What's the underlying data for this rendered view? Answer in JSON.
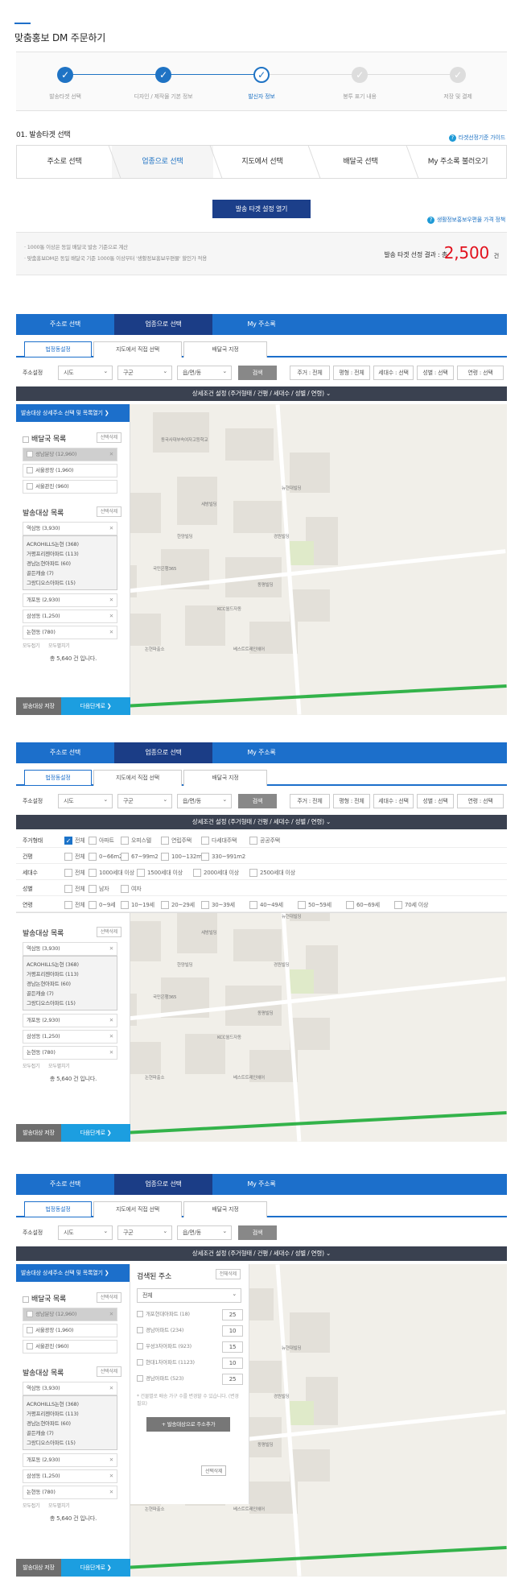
{
  "page": {
    "title": "맞춤홍보 DM 주문하기"
  },
  "steps": [
    {
      "label": "발송타겟 선택",
      "state": "done"
    },
    {
      "label": "디자인 / 제작물 기본 정보",
      "state": "done"
    },
    {
      "label": "발신자 정보",
      "state": "current"
    },
    {
      "label": "봉투 표기 내용",
      "state": "todo"
    },
    {
      "label": "저장 및 결제",
      "state": "todo"
    }
  ],
  "section1": {
    "title": "01. 발송타겟 선택",
    "guide": "타겟선정기준 가이드",
    "tabs": [
      "주소로 선택",
      "업종으로 선택",
      "지도에서 선택",
      "배달국 선택",
      "My 주소록 불러오기"
    ],
    "selected_tab": 1,
    "open_button": "발송 타겟 설정 열기",
    "price_link": "생활정보홍보우편물 가격 정책",
    "note1": "· 1000통 이상은 동일 배달국 발송 기준으로 계산",
    "note2": "· 맞춤홍보DM은 동일 배달국 기준 1000통 이상부터 '생활정보홍보우편물' 할인가 적용",
    "result_label": "발송 타겟 선정 결과 : 총",
    "result_value": "2,500",
    "result_unit": "건"
  },
  "module": {
    "nav": [
      "주소로 선택",
      "업종으로 선택",
      "My 주소록"
    ],
    "subtabs": [
      "법정동설정",
      "지도에서 직접 선택",
      "배달국 지정"
    ],
    "addr_label": "주소설정",
    "selects": [
      "시도",
      "구군",
      "읍/면/동"
    ],
    "search": "검색",
    "chips": [
      "주거 : 전체",
      "평형 : 전체",
      "세대수 : 선택",
      "성별 : 선택",
      "연령 : 선택"
    ],
    "cond_bar": "상세조건 설정 (주거형태 / 건평 / 세대수 / 성별 / 연령)  ⌄"
  },
  "side": {
    "header": "발송대상 상세주소 선택 및 목록열기  ❯",
    "office_title": "배달국 목록",
    "delete": "선택삭제",
    "offices": [
      "성남분당 (12,960)",
      "서울광장 (1,960)",
      "서울관진 (960)"
    ],
    "target_title": "발송대상 목록",
    "targets": [
      {
        "name": "역삼동 (3,930)"
      },
      {
        "name": "개포동 (2,930)"
      },
      {
        "name": "삼성동 (1,250)"
      },
      {
        "name": "논현동 (780)"
      }
    ],
    "sub_items": [
      "ACROHILLS논현 (368)",
      "거평프리젠아파트 (113)",
      "경남논현아파트 (60)",
      "골든캐슬 (7)",
      "그랑디오스아파트 (15)"
    ],
    "fold_all": "모두접기",
    "unfold_all": "모두펼치기",
    "total": "총 5,640 건 입니다.",
    "save_btn": "발송대상 저장",
    "next_btn": "다음단계로  ❯"
  },
  "filters": [
    {
      "label": "주거형태",
      "opts": [
        "전체",
        "아파트",
        "오피스텔",
        "연립주택",
        "다세대주택",
        "공공주택"
      ]
    },
    {
      "label": "건평",
      "opts": [
        "전체",
        "0~66m2",
        "67~99m2",
        "100~132m2",
        "330~991m2"
      ]
    },
    {
      "label": "세대수",
      "opts": [
        "전체",
        "1000세대 이상",
        "1500세대 이상",
        "2000세대 이상",
        "2500세대 이상"
      ]
    },
    {
      "label": "성별",
      "opts": [
        "전체",
        "남자",
        "여자"
      ]
    },
    {
      "label": "연령",
      "opts": [
        "전체",
        "0~9세",
        "10~19세",
        "20~29세",
        "30~39세",
        "40~49세",
        "50~59세",
        "60~69세",
        "70세 이상"
      ]
    }
  ],
  "search_result": {
    "title": "검색된 주소",
    "delete": "전체삭제",
    "select": "전체",
    "items": [
      {
        "name": "개포현대아파트 (18)",
        "val": "25"
      },
      {
        "name": "경남아파트 (234)",
        "val": "10"
      },
      {
        "name": "우성3차아파트 (923)",
        "val": "15"
      },
      {
        "name": "현대1차아파트 (1123)",
        "val": "10"
      },
      {
        "name": "경남아파트 (523)",
        "val": "25"
      }
    ],
    "note": "* 건물별로 배송 가구 수를 변경할 수 있습니다. (변경 필요)",
    "add_btn": "+ 발송대상으로 주소추가",
    "map_tag": "선택삭제"
  },
  "map_labels": [
    "동국사대부속여자고등학교",
    "우리들병원",
    "세방빌딩",
    "동평빌딩",
    "선인빌딩",
    "뉴현대빌딩",
    "국민은행365",
    "KCC월드자동",
    "논현파출소",
    "베스트트레인헤어",
    "웰컴빌딩",
    "한양빌딩",
    "경원빌딩",
    "현대아파트"
  ]
}
